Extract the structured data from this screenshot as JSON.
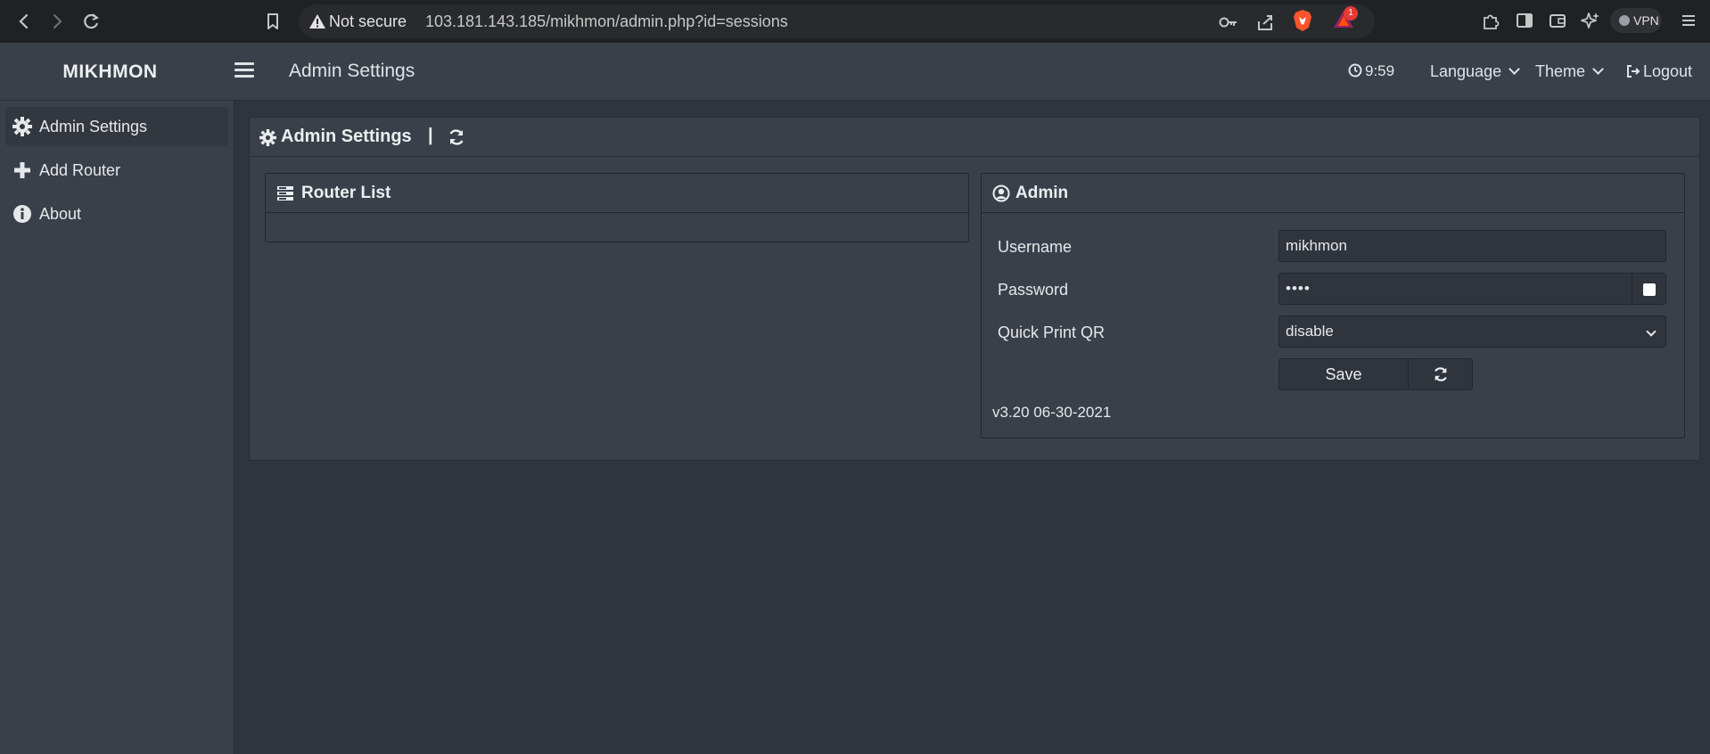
{
  "browser": {
    "security_label": "Not secure",
    "url": "103.181.143.185/mikhmon/admin.php?id=sessions",
    "badge_count": "1",
    "vpn_label": "VPN"
  },
  "header": {
    "brand": "MIKHMON",
    "title": "Admin Settings",
    "time": "9:59",
    "language_label": "Language",
    "theme_label": "Theme",
    "logout_label": "Logout"
  },
  "sidebar": {
    "items": [
      {
        "label": "Admin Settings",
        "icon": "gear-icon",
        "active": true
      },
      {
        "label": "Add Router",
        "icon": "plus-icon",
        "active": false
      },
      {
        "label": "About",
        "icon": "info-icon",
        "active": false
      }
    ]
  },
  "main": {
    "title": "Admin Settings",
    "separator": "|",
    "router_list": {
      "title": "Router List"
    },
    "admin": {
      "title": "Admin",
      "username_label": "Username",
      "username_value": "mikhmon",
      "password_label": "Password",
      "password_value": "••••",
      "quick_print_label": "Quick Print QR",
      "quick_print_value": "disable",
      "save_label": "Save",
      "version": "v3.20 06-30-2021"
    }
  },
  "colors": {
    "header_bg": "#3a4049",
    "page_bg": "#2f343d",
    "browser_bg": "#202124",
    "badge": "#e53935"
  }
}
